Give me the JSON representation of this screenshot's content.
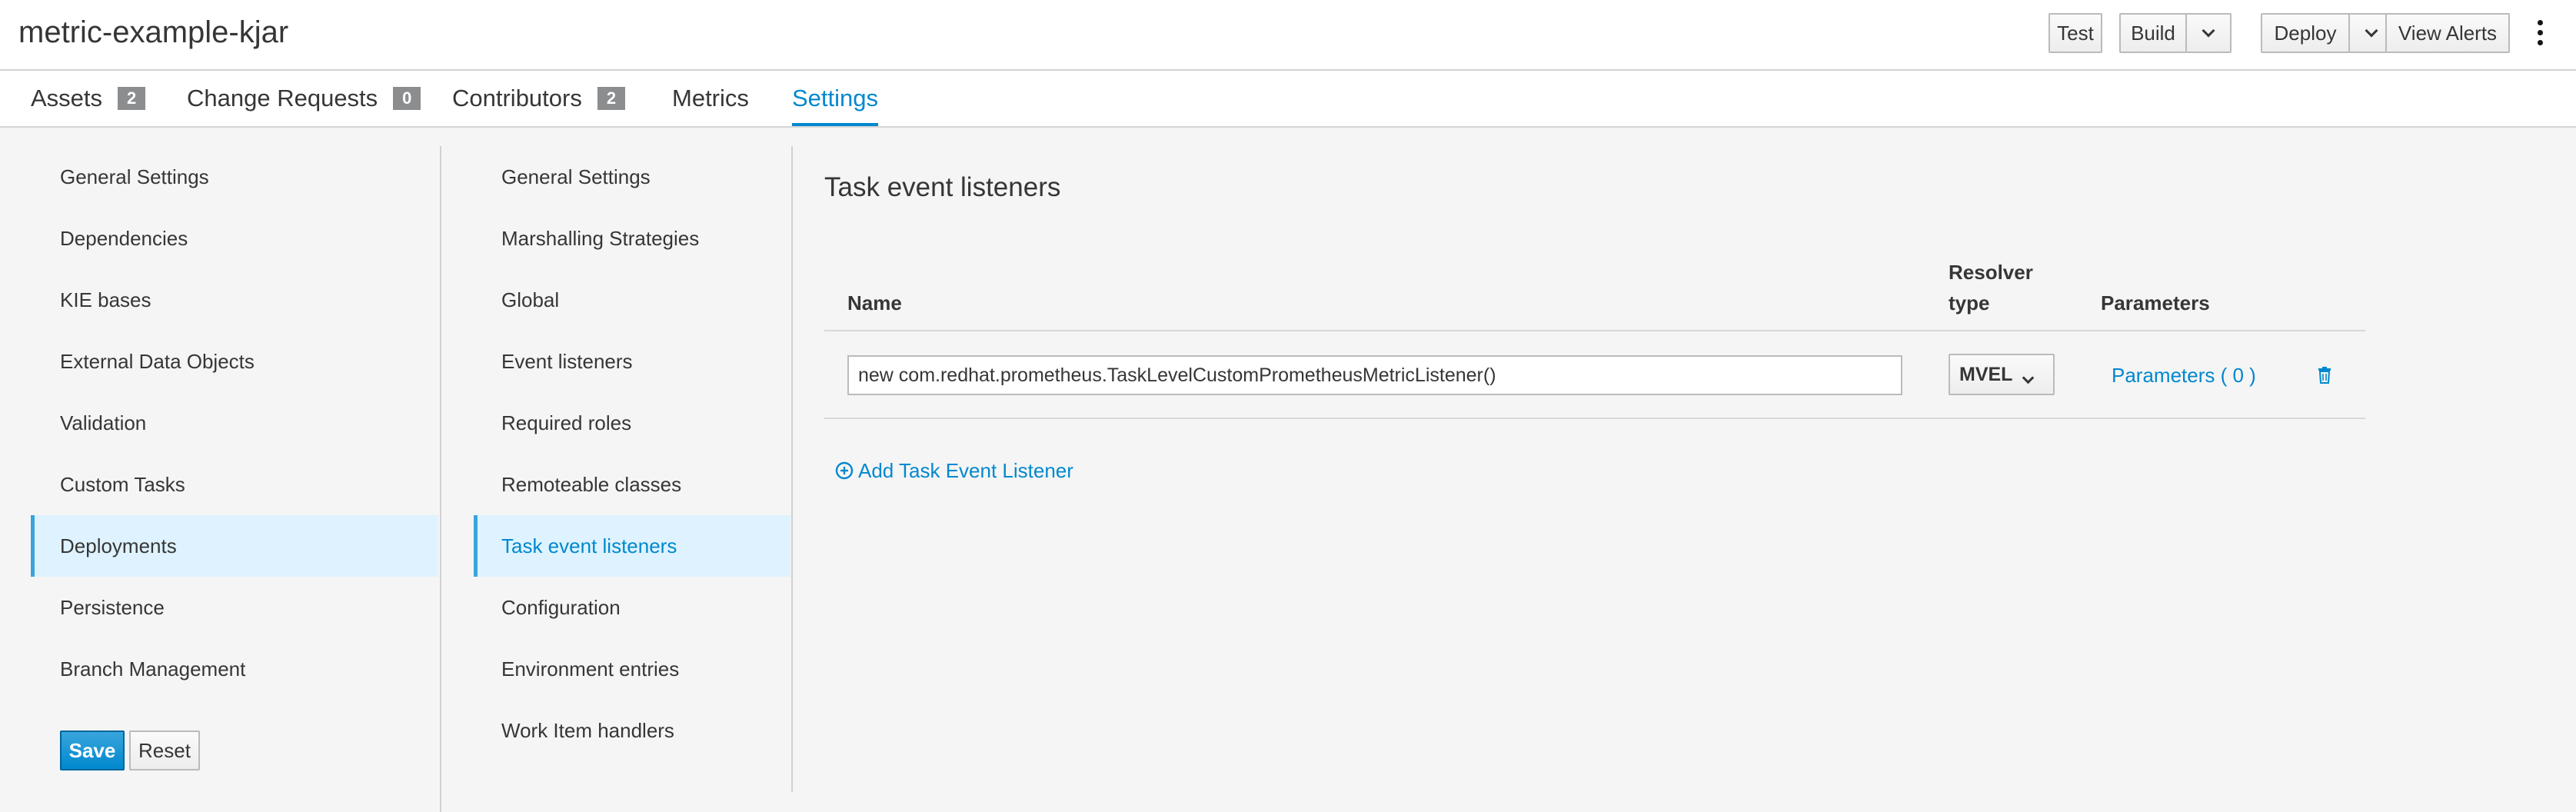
{
  "header": {
    "project_title": "metric-example-kjar",
    "buttons": {
      "test": "Test",
      "build": "Build",
      "deploy": "Deploy",
      "view_alerts": "View Alerts"
    },
    "kebab_icon": "more-vertical-icon"
  },
  "tabs": [
    {
      "label": "Assets",
      "badge": "2"
    },
    {
      "label": "Change Requests",
      "badge": "0"
    },
    {
      "label": "Contributors",
      "badge": "2"
    },
    {
      "label": "Metrics"
    },
    {
      "label": "Settings",
      "active": true
    }
  ],
  "settings_nav": {
    "items": [
      "General Settings",
      "Dependencies",
      "KIE bases",
      "External Data Objects",
      "Validation",
      "Custom Tasks",
      "Deployments",
      "Persistence",
      "Branch Management"
    ],
    "active": "Deployments",
    "save_label": "Save",
    "reset_label": "Reset"
  },
  "deployments_nav": {
    "items": [
      "General Settings",
      "Marshalling Strategies",
      "Global",
      "Event listeners",
      "Required roles",
      "Remoteable classes",
      "Task event listeners",
      "Configuration",
      "Environment entries",
      "Work Item handlers"
    ],
    "active": "Task event listeners"
  },
  "main": {
    "title": "Task event listeners",
    "columns": {
      "name": "Name",
      "resolver_line1": "Resolver",
      "resolver_line2": "type",
      "parameters": "Parameters"
    },
    "rows": [
      {
        "name": "new com.redhat.prometheus.TaskLevelCustomPrometheusMetricListener()",
        "resolver_type": "MVEL",
        "parameters_link": "Parameters ( 0 )",
        "delete_icon": "trash-icon"
      }
    ],
    "add_label": "Add Task Event Listener",
    "add_icon": "plus-circle-icon"
  },
  "colors": {
    "accent": "#0088ce",
    "active_nav_bg": "#def3ff",
    "active_nav_border": "#39a5dc",
    "badge_bg": "#8b8d8f",
    "page_bg": "#f5f5f5"
  }
}
